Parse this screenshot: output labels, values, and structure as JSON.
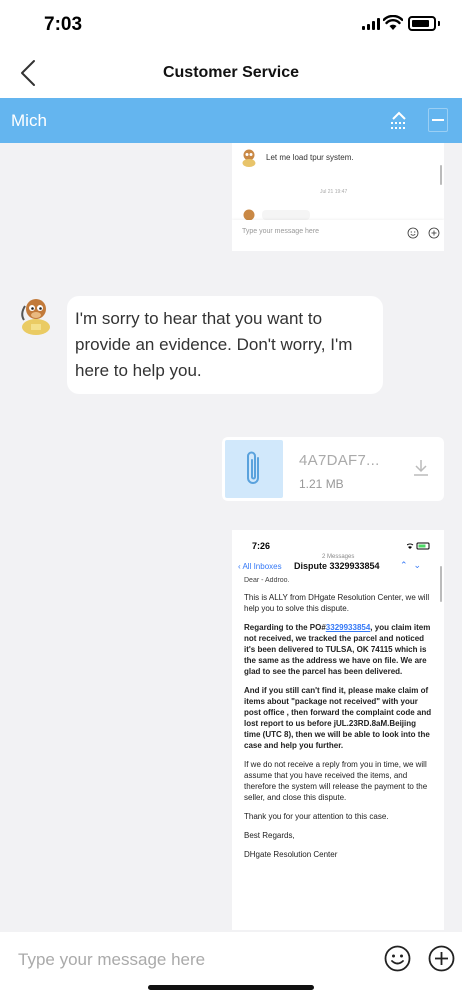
{
  "status_bar": {
    "time": "7:03"
  },
  "nav": {
    "title": "Customer Service"
  },
  "agent_bar": {
    "name": "Mich"
  },
  "mini_widget": {
    "message": "Let me load tpur system.",
    "timestamp": "Jul 21 19:47",
    "input_placeholder": "Type your message here"
  },
  "agent_message": {
    "text": "I'm sorry to hear that you want to provide an evidence. Don't worry, I'm here to help you."
  },
  "file_message": {
    "name": "4A7DAF7...",
    "size": "1.21 MB"
  },
  "screenshot_message": {
    "time": "7:26",
    "message_count": "2 Messages",
    "back_label": "All Inboxes",
    "subject": "Dispute 3329933854",
    "cutoff_line": "Dear - Addroo.",
    "intro": "This is ALLY from DHgate Resolution Center, we will help you to solve this dispute.",
    "para1_prefix": "Regarding to the PO#",
    "para1_link": "3329933854",
    "para1_suffix": ", you claim item not received, we tracked the parcel and noticed it's been delivered to  TULSA, OK 74115 which is the same as the address we have on file. We are glad to see the parcel has been delivered.",
    "para2": "And if you still can't find it, please make claim of items about \"package not received\" with your post office , then forward the complaint code and lost report to us before jUL.23RD.8aM.Beijing time (UTC 8), then we will be able to look into the case and help you further.",
    "para3": "If we do not receive a reply from you in time, we will assume that you have received the items, and therefore the system will release the payment to the seller, and close this dispute.",
    "para4": "Thank you for your attention to this case.",
    "closing": "Best Regards,",
    "signature": "DHgate Resolution Center"
  },
  "input_bar": {
    "placeholder": "Type your message here"
  },
  "colors": {
    "accent": "#64b5ef",
    "file_icon_bg": "#d1e8fb",
    "link": "#3478f6"
  }
}
